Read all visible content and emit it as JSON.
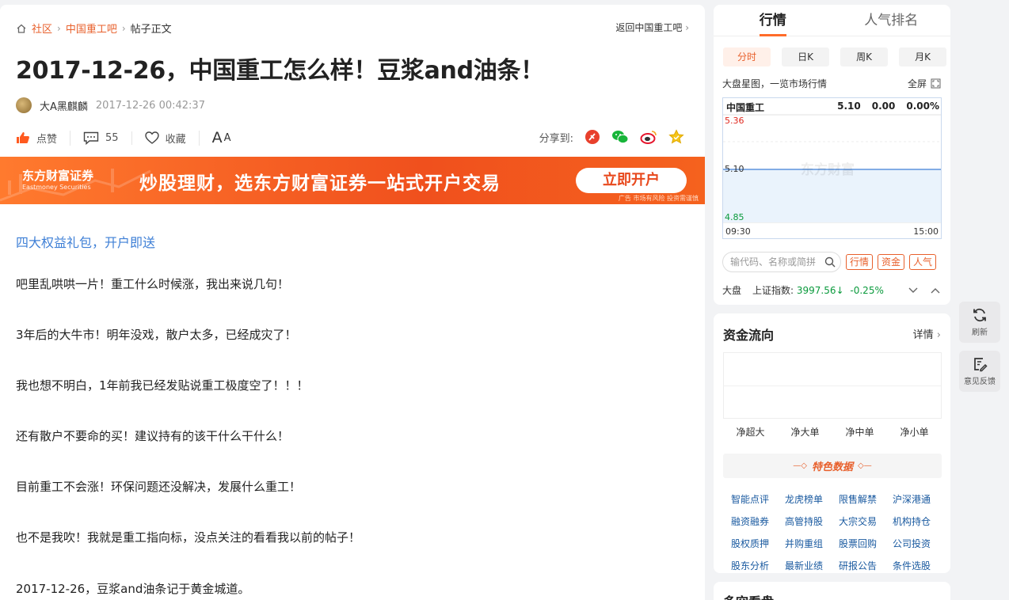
{
  "breadcrumb": {
    "home": "社区",
    "forum": "中国重工吧",
    "current": "帖子正文",
    "back": "返回中国重工吧"
  },
  "post": {
    "title": "2017-12-26，中国重工怎么样！豆浆and油条！",
    "author": "大A黑麒麟",
    "date": "2017-12-26 00:42:37",
    "like": "点赞",
    "comments": "55",
    "favorite": "收藏",
    "font_size": "A",
    "share_label": "分享到:",
    "gift_link": "四大权益礼包，开户即送",
    "paragraphs": [
      "吧里乱哄哄一片！重工什么时候涨，我出来说几句！",
      "3年后的大牛市！明年没戏，散户太多，已经成灾了！",
      "我也想不明白，1年前我已经发贴说重工极度空了！！！",
      "还有散户不要命的买！建议持有的该干什么干什么！",
      "目前重工不会涨！环保问题还没解决，发展什么重工！",
      "也不是我吹！我就是重工指向标，没点关注的看看我以前的帖子！",
      "2017-12-26，豆浆and油条记于黄金城道。"
    ]
  },
  "banner": {
    "logo_cn": "东方财富证券",
    "logo_en": "Eastmoney Securities",
    "slogan": "炒股理财，选东方财富证券一站式开户交易",
    "button": "立即开户",
    "tip": "广告 市场有风险 投资需谨慎"
  },
  "market": {
    "tabs": [
      "行情",
      "人气排名"
    ],
    "periods": [
      "分时",
      "日K",
      "周K",
      "月K"
    ],
    "subtitle": "大盘星图，一览市场行情",
    "fullscreen": "全屏",
    "stock_name": "中国重工",
    "price": "5.10",
    "change": "0.00",
    "pct": "0.00%",
    "y_high": "5.36",
    "y_mid": "5.10",
    "y_low": "4.85",
    "t_start": "09:30",
    "t_end": "15:00",
    "watermark": "东方财富",
    "search_placeholder": "输代码、名称或简拼",
    "tags": [
      "行情",
      "资金",
      "人气"
    ],
    "index_label": "大盘",
    "index_name": "上证指数:",
    "index_value": "3997.56↓",
    "index_pct": "-0.25%"
  },
  "fund_flow": {
    "title": "资金流向",
    "detail": "详情",
    "labels": [
      "净超大",
      "净大单",
      "净中单",
      "净小单"
    ],
    "featured": "特色数据",
    "links": [
      "智能点评",
      "龙虎榜单",
      "限售解禁",
      "沪深港通",
      "融资融券",
      "高管持股",
      "大宗交易",
      "机构持仓",
      "股权质押",
      "并购重组",
      "股票回购",
      "公司投资",
      "股东分析",
      "最新业绩",
      "研报公告",
      "条件选股"
    ]
  },
  "next_section": "多空看盘",
  "tools": {
    "refresh": "刷新",
    "feedback": "意见反馈"
  },
  "colors": {
    "accent": "#e8602c",
    "up": "#e0281e",
    "down": "#0a9a3c",
    "link": "#3e7fd6"
  }
}
